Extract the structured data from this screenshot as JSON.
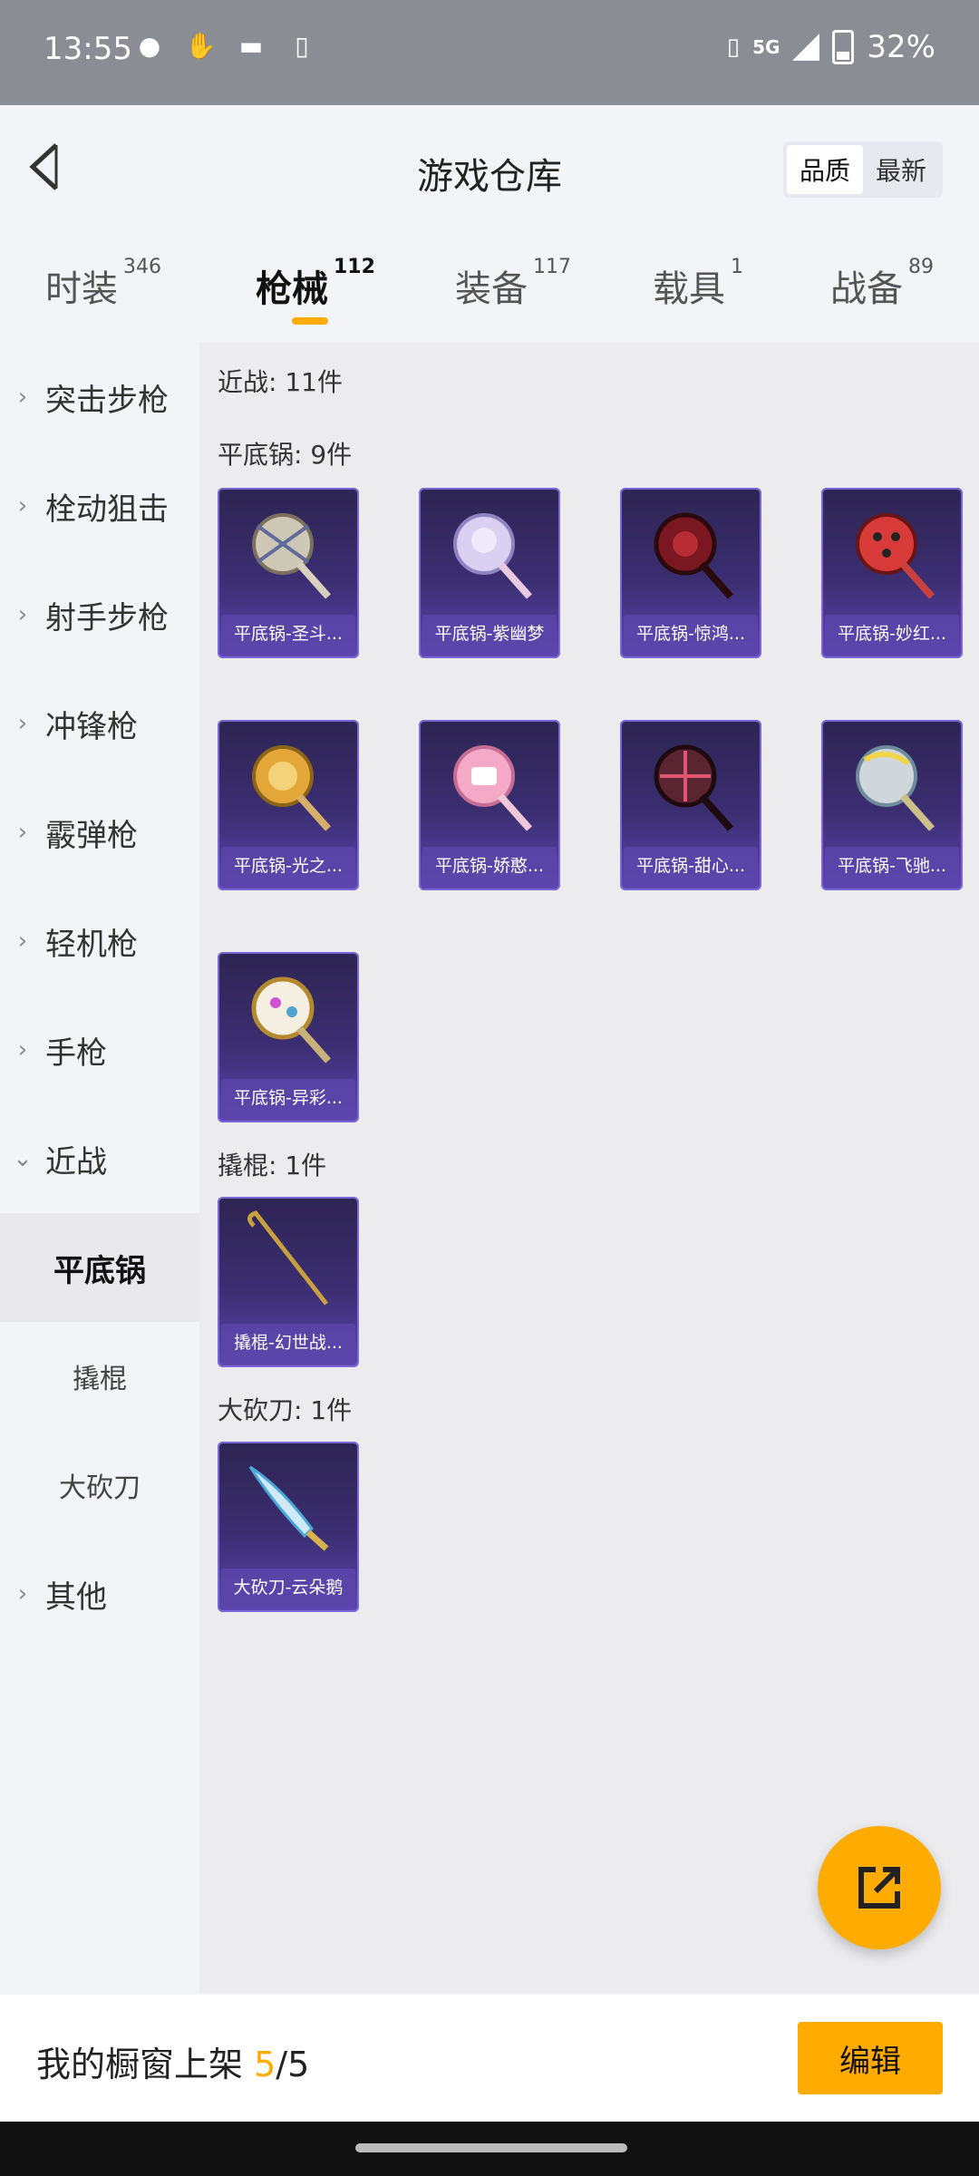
{
  "status": {
    "time": "13:55",
    "network": "5G",
    "battery": "32%"
  },
  "header": {
    "title": "游戏仓库",
    "sort": {
      "quality": "品质",
      "latest": "最新"
    }
  },
  "tabs": [
    {
      "label": "时装",
      "count": "346"
    },
    {
      "label": "枪械",
      "count": "112"
    },
    {
      "label": "装备",
      "count": "117"
    },
    {
      "label": "载具",
      "count": "1"
    },
    {
      "label": "战备",
      "count": "89"
    }
  ],
  "sidebar": {
    "items": [
      "突击步枪",
      "栓动狙击",
      "射手步枪",
      "冲锋枪",
      "霰弹枪",
      "轻机枪",
      "手枪",
      "近战"
    ],
    "sub": [
      "平底锅",
      "撬棍",
      "大砍刀"
    ],
    "other": "其他"
  },
  "main": {
    "melee_header": "近战: 11件",
    "pan_header": "平底锅: 9件",
    "crowbar_header": "撬棍: 1件",
    "machete_header": "大砍刀: 1件",
    "pans": [
      "平底锅-圣斗...",
      "平底锅-紫幽梦",
      "平底锅-惊鸿...",
      "平底锅-妙红...",
      "平底锅-光之...",
      "平底锅-娇憨...",
      "平底锅-甜心...",
      "平底锅-飞驰...",
      "平底锅-异彩..."
    ],
    "crowbar": "撬棍-幻世战...",
    "machete": "大砍刀-云朵鹅"
  },
  "bottom": {
    "prefix": "我的橱窗上架 ",
    "current": "5",
    "total": "/5",
    "edit": "编辑"
  },
  "colors": {
    "accent": "#ffab00",
    "card": "#3b2e72"
  }
}
